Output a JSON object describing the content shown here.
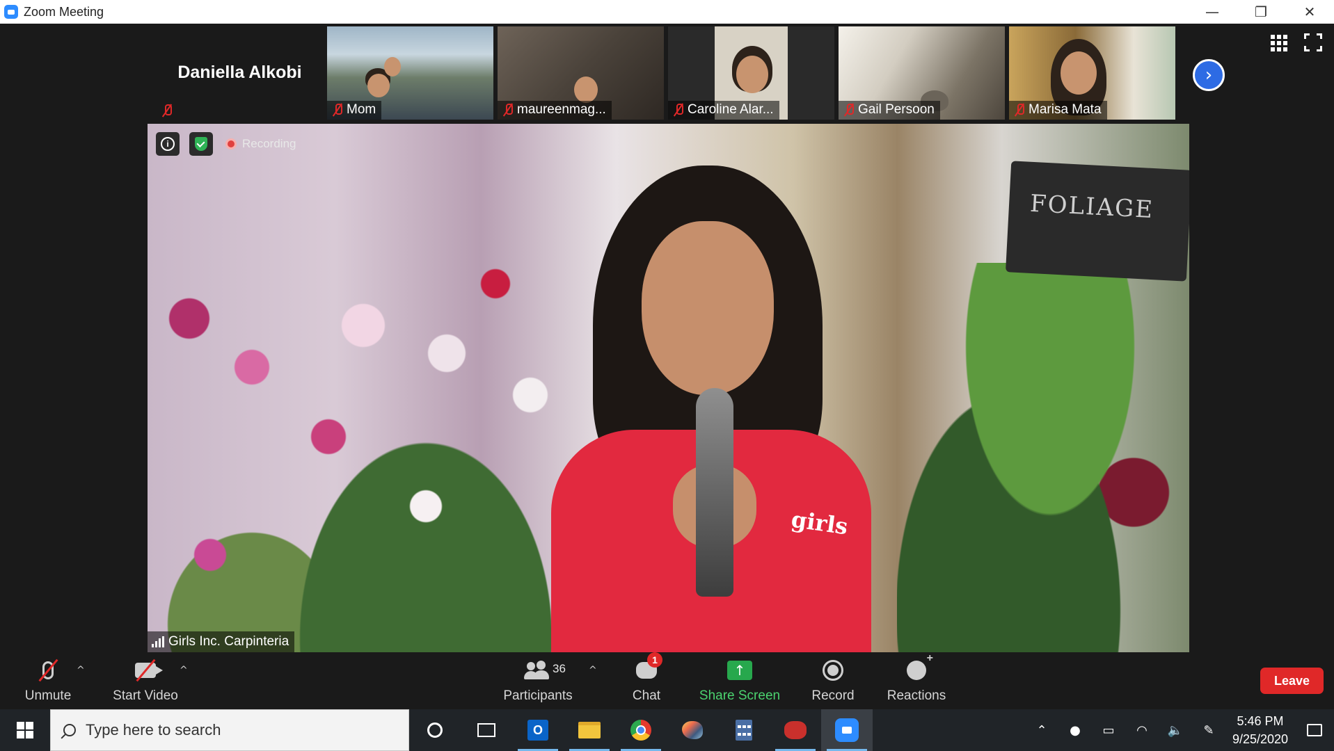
{
  "window": {
    "title": "Zoom Meeting",
    "controls": {
      "minimize": "—",
      "restore": "❐",
      "close": "✕"
    }
  },
  "gallery_strip": {
    "participants": [
      {
        "name": "Daniella Alkobi",
        "muted": true,
        "video": false
      },
      {
        "name": "Mom",
        "muted": true,
        "video": true
      },
      {
        "name": "maureenmag...",
        "muted": true,
        "video": true
      },
      {
        "name": "Caroline Alar...",
        "muted": true,
        "video": true
      },
      {
        "name": "Gail Persoon",
        "muted": true,
        "video": true
      },
      {
        "name": "Marisa Mata",
        "muted": true,
        "video": true
      }
    ],
    "next_page_icon": "chevron-right-icon",
    "next_page_glyph": "›"
  },
  "main_video": {
    "speaker_name": "Girls Inc. Carpinteria",
    "recording_label": "Recording",
    "info_icon": "i",
    "sign_text": "FOLIAGE",
    "shirt_text": "girls"
  },
  "toolbar": {
    "unmute_label": "Unmute",
    "start_video_label": "Start Video",
    "participants_label": "Participants",
    "participants_count": "36",
    "chat_label": "Chat",
    "chat_badge": "1",
    "share_screen_label": "Share Screen",
    "share_glyph": "↑",
    "record_label": "Record",
    "reactions_label": "Reactions",
    "leave_label": "Leave",
    "caret": "^",
    "accent_colors": {
      "share": "#4bd36f",
      "leave": "#e02828",
      "badge": "#e02828"
    }
  },
  "taskbar": {
    "search_placeholder": "Type here to search",
    "outlook_glyph": "O",
    "time": "5:46 PM",
    "date": "9/25/2020",
    "tray_glyphs": {
      "chevron": "⌃",
      "mic": "●",
      "battery": "▭",
      "wifi": "◠",
      "volume": "🔈",
      "pen": "✎"
    }
  }
}
